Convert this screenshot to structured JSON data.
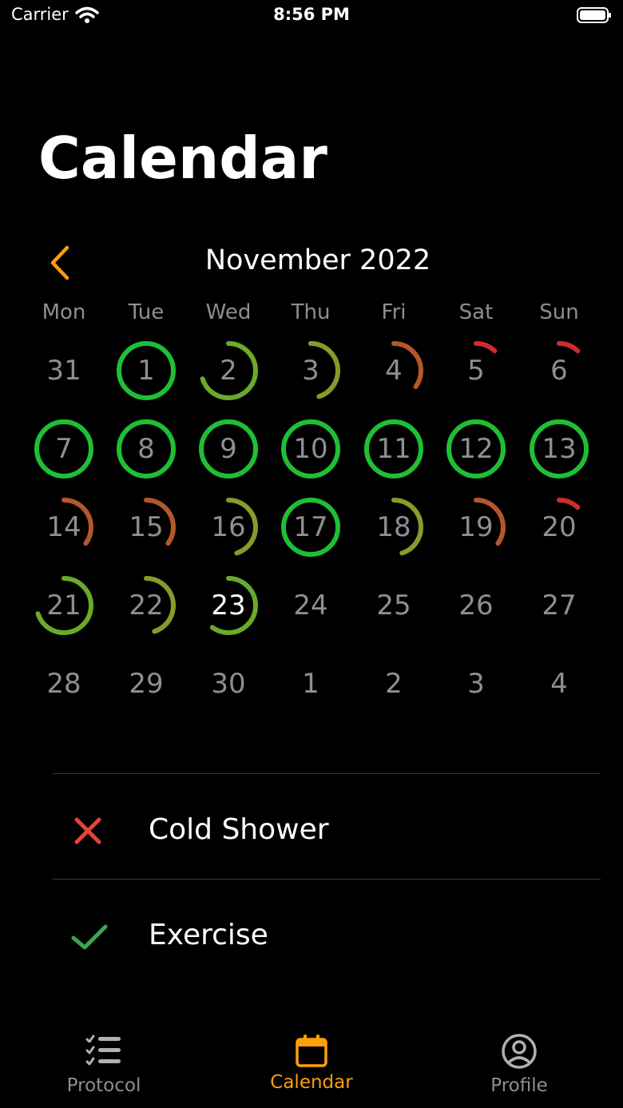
{
  "status_bar": {
    "carrier": "Carrier",
    "time": "8:56 PM"
  },
  "page": {
    "title": "Calendar"
  },
  "calendar": {
    "month_label": "November 2022",
    "weekdays": [
      "Mon",
      "Tue",
      "Wed",
      "Thu",
      "Fri",
      "Sat",
      "Sun"
    ],
    "weeks": [
      [
        {
          "day": "31",
          "progress": 0
        },
        {
          "day": "1",
          "progress": 1.0,
          "color": "#1fbf35"
        },
        {
          "day": "2",
          "progress": 0.7,
          "color": "#6aaa2a"
        },
        {
          "day": "3",
          "progress": 0.45,
          "color": "#8a9a2a"
        },
        {
          "day": "4",
          "progress": 0.35,
          "color": "#b2582a"
        },
        {
          "day": "5",
          "progress": 0.12,
          "color": "#d22b2b"
        },
        {
          "day": "6",
          "progress": 0.12,
          "color": "#d22b2b"
        }
      ],
      [
        {
          "day": "7",
          "progress": 1.0,
          "color": "#1fbf35"
        },
        {
          "day": "8",
          "progress": 1.0,
          "color": "#1fbf35"
        },
        {
          "day": "9",
          "progress": 1.0,
          "color": "#1fbf35"
        },
        {
          "day": "10",
          "progress": 1.0,
          "color": "#1fbf35"
        },
        {
          "day": "11",
          "progress": 1.0,
          "color": "#1fbf35"
        },
        {
          "day": "12",
          "progress": 1.0,
          "color": "#1fbf35"
        },
        {
          "day": "13",
          "progress": 1.0,
          "color": "#1fbf35"
        }
      ],
      [
        {
          "day": "14",
          "progress": 0.35,
          "color": "#b2582a"
        },
        {
          "day": "15",
          "progress": 0.35,
          "color": "#b2582a"
        },
        {
          "day": "16",
          "progress": 0.45,
          "color": "#8a9a2a"
        },
        {
          "day": "17",
          "progress": 1.0,
          "color": "#1fbf35"
        },
        {
          "day": "18",
          "progress": 0.45,
          "color": "#8a9a2a"
        },
        {
          "day": "19",
          "progress": 0.35,
          "color": "#b2582a"
        },
        {
          "day": "20",
          "progress": 0.12,
          "color": "#d22b2b"
        }
      ],
      [
        {
          "day": "21",
          "progress": 0.7,
          "color": "#6aaa2a"
        },
        {
          "day": "22",
          "progress": 0.45,
          "color": "#8a9a2a"
        },
        {
          "day": "23",
          "progress": 0.6,
          "color": "#6aaa2a",
          "today": true
        },
        {
          "day": "24",
          "progress": 0
        },
        {
          "day": "25",
          "progress": 0
        },
        {
          "day": "26",
          "progress": 0
        },
        {
          "day": "27",
          "progress": 0
        }
      ],
      [
        {
          "day": "28",
          "progress": 0
        },
        {
          "day": "29",
          "progress": 0
        },
        {
          "day": "30",
          "progress": 0
        },
        {
          "day": "1",
          "progress": 0
        },
        {
          "day": "2",
          "progress": 0
        },
        {
          "day": "3",
          "progress": 0
        },
        {
          "day": "4",
          "progress": 0
        }
      ]
    ]
  },
  "habits": [
    {
      "label": "Cold Shower",
      "status": "failed",
      "icon": "x-icon",
      "color": "#e5443a"
    },
    {
      "label": "Exercise",
      "status": "done",
      "icon": "check-icon",
      "color": "#3aa84a"
    }
  ],
  "tab_bar": {
    "tabs": [
      {
        "label": "Protocol",
        "icon": "checklist-icon",
        "active": false
      },
      {
        "label": "Calendar",
        "icon": "calendar-icon",
        "active": true
      },
      {
        "label": "Profile",
        "icon": "person-circle-icon",
        "active": false
      }
    ]
  },
  "colors": {
    "accent": "#ff9f0a",
    "complete": "#1fbf35",
    "muted": "#8e8e93"
  }
}
